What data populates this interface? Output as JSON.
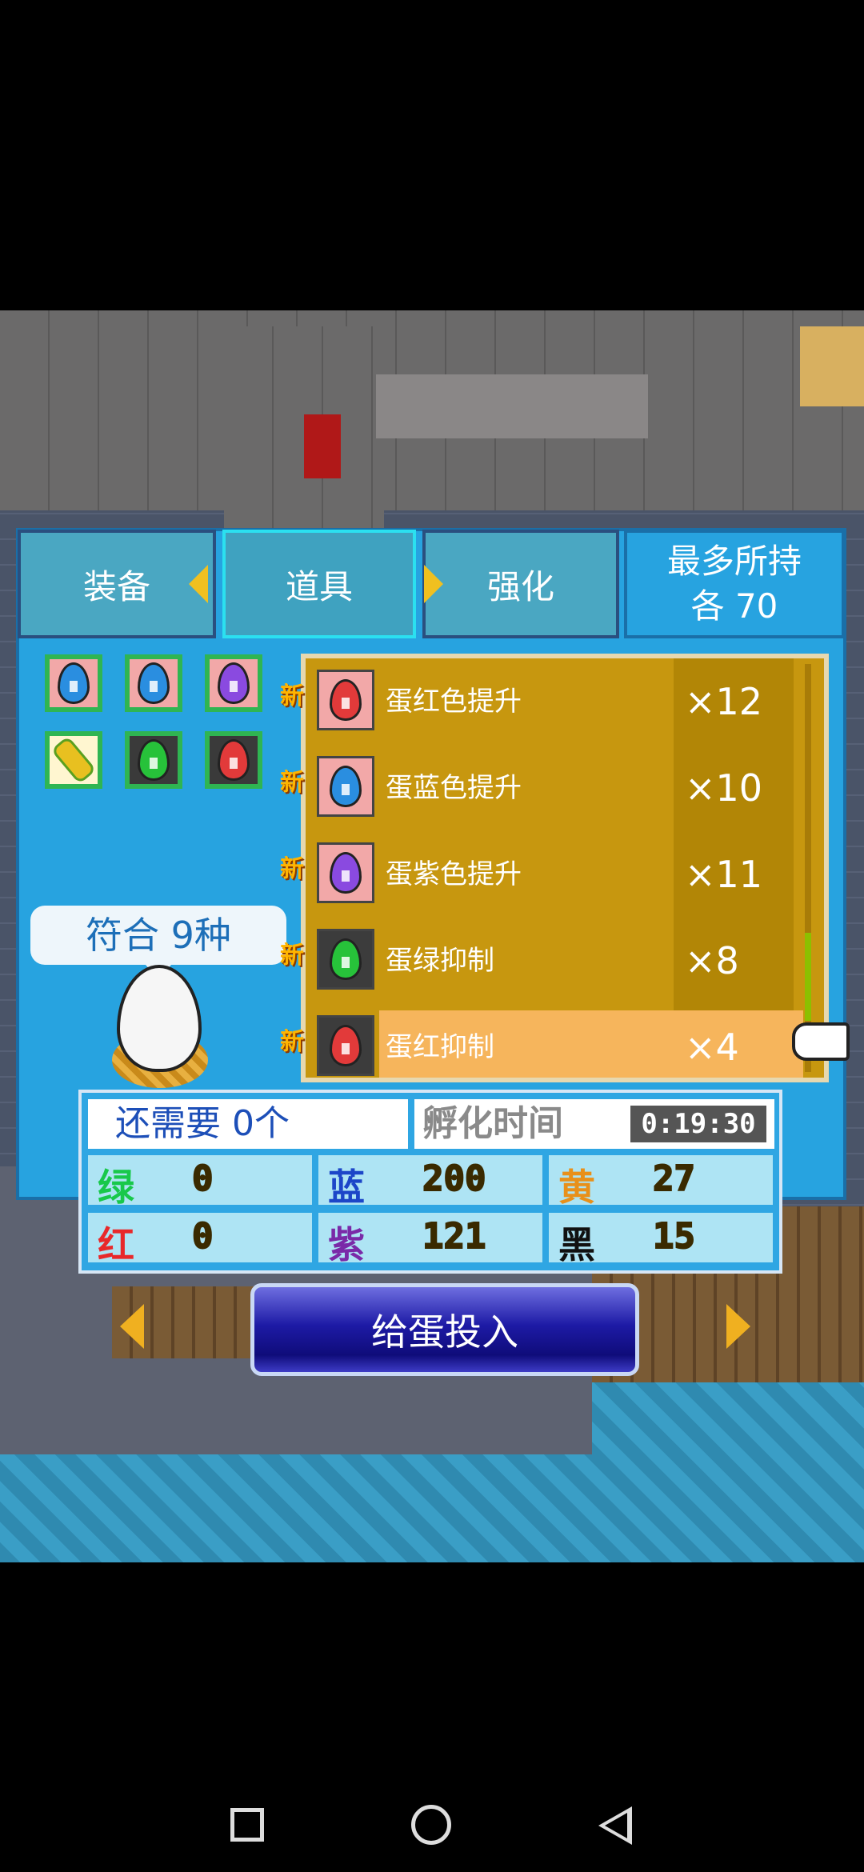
{
  "tabs": [
    {
      "label": "装备"
    },
    {
      "label": "道具"
    },
    {
      "label": "强化"
    }
  ],
  "max_hold": {
    "line1": "最多所持",
    "line2": "各 70"
  },
  "match": {
    "text": "符合 9种"
  },
  "new_badge": "新",
  "items": [
    {
      "name": "蛋红色提升",
      "qty": "×12",
      "egg_color": "#e23a3a",
      "is_new": true
    },
    {
      "name": "蛋蓝色提升",
      "qty": "×10",
      "egg_color": "#2a8ee0",
      "is_new": true
    },
    {
      "name": "蛋紫色提升",
      "qty": "×11",
      "egg_color": "#8a4ae0",
      "is_new": true
    },
    {
      "name": "蛋绿抑制",
      "qty": "×8",
      "egg_color": "#27c23a",
      "is_new": true
    },
    {
      "name": "蛋红抑制",
      "qty": "×4",
      "egg_color": "#e23a3a",
      "is_new": true,
      "selected": true
    }
  ],
  "slots": [
    {
      "egg_color": "#2a8ee0"
    },
    {
      "egg_color": "#2a8ee0"
    },
    {
      "egg_color": "#8a4ae0"
    },
    {
      "egg_color": "corn"
    },
    {
      "egg_color": "#27c23a"
    },
    {
      "egg_color": "#e23a3a"
    }
  ],
  "needed": "还需要 0个",
  "hatch": {
    "label": "孵化时间",
    "time": "0:19:30"
  },
  "colors_stats": [
    {
      "label": "绿",
      "value": "0",
      "color": "#18c84a"
    },
    {
      "label": "蓝",
      "value": "200",
      "color": "#1c46c8"
    },
    {
      "label": "黄",
      "value": "27",
      "color": "#e8901a"
    },
    {
      "label": "红",
      "value": "0",
      "color": "#e8282a"
    },
    {
      "label": "紫",
      "value": "121",
      "color": "#7a2aa8"
    },
    {
      "label": "黑",
      "value": "15",
      "color": "#111111"
    }
  ],
  "feed_button": "给蛋投入"
}
